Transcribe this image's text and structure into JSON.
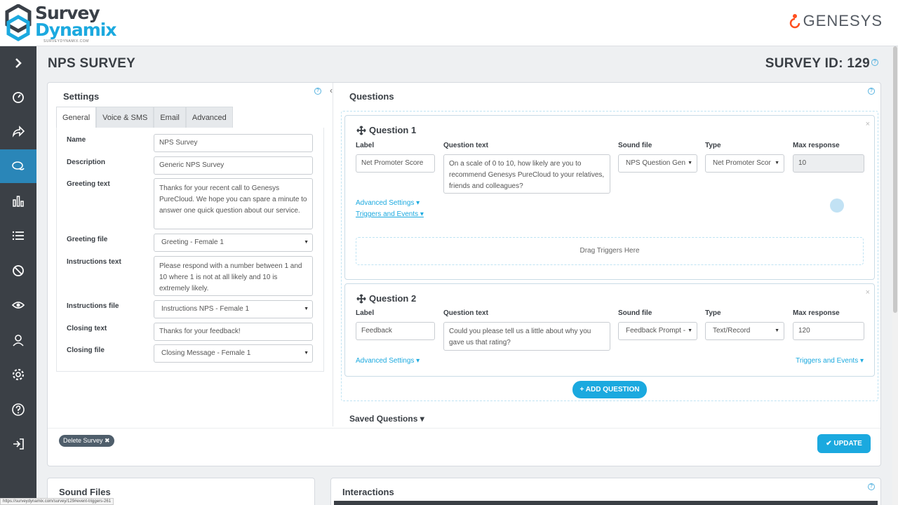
{
  "brand": {
    "logo_line1": "Survey",
    "logo_line2": "Dynamix",
    "logo_sub": "SURVEYDYNAMIX.COM",
    "partner": "GENESYS"
  },
  "sidebar": {
    "items": [
      {
        "icon": "chevron-right-icon"
      },
      {
        "icon": "dashboard-icon"
      },
      {
        "icon": "share-icon"
      },
      {
        "icon": "chat-icon",
        "active": true
      },
      {
        "icon": "bar-chart-icon"
      },
      {
        "icon": "list-icon"
      },
      {
        "icon": "block-icon"
      },
      {
        "icon": "eye-icon"
      },
      {
        "icon": "user-icon"
      },
      {
        "icon": "gear-icon"
      },
      {
        "icon": "help-icon"
      },
      {
        "icon": "logout-icon"
      }
    ]
  },
  "page": {
    "title": "NPS SURVEY",
    "survey_id": "SURVEY ID: 129"
  },
  "settings": {
    "title": "Settings",
    "tabs": [
      "General",
      "Voice & SMS",
      "Email",
      "Advanced"
    ],
    "fields": {
      "name_label": "Name",
      "name_value": "NPS Survey",
      "description_label": "Description",
      "description_value": "Generic NPS Survey",
      "greeting_text_label": "Greeting text",
      "greeting_text_value": "Thanks for your recent call to Genesys PureCloud. We hope you can spare a minute to answer one quick question about our service.",
      "greeting_file_label": "Greeting file",
      "greeting_file_value": "Greeting - Female 1",
      "instructions_text_label": "Instructions text",
      "instructions_text_value": "Please respond with a number between 1 and 10 where 1 is not at all likely and 10 is extremely likely.",
      "instructions_file_label": "Instructions file",
      "instructions_file_value": "Instructions NPS - Female 1",
      "closing_text_label": "Closing text",
      "closing_text_value": "Thanks for your feedback!",
      "closing_file_label": "Closing file",
      "closing_file_value": "Closing Message - Female 1"
    }
  },
  "questions": {
    "title": "Questions",
    "columns": {
      "label": "Label",
      "question_text": "Question text",
      "sound_file": "Sound file",
      "type": "Type",
      "max_response": "Max response"
    },
    "items": [
      {
        "title": "Question 1",
        "label": "Net Promoter Score",
        "question_text": "On a scale of 0 to 10, how likely are you to recommend Genesys PureCloud to your relatives, friends and colleagues?",
        "sound_file": "NPS Question Gen",
        "type": "Net Promoter Scor",
        "max_response": "10",
        "advanced_settings": "Advanced Settings ▾",
        "triggers": "Triggers and Events ▾",
        "drop_zone": "Drag Triggers Here"
      },
      {
        "title": "Question 2",
        "label": "Feedback",
        "question_text": "Could you please tell us a little about why you gave us that rating?",
        "sound_file": "Feedback Prompt -",
        "type": "Text/Record",
        "max_response": "120",
        "advanced_settings": "Advanced Settings ▾",
        "triggers": "Triggers and Events ▾"
      }
    ],
    "add_button": "+ ADD QUESTION",
    "saved_questions": "Saved Questions ▾"
  },
  "actions": {
    "delete": "Delete Survey ✖",
    "update": "✔ UPDATE"
  },
  "bottom": {
    "sound_files": "Sound Files",
    "interactions": "Interactions"
  },
  "status_url": "https://surveydynamix.com/survey/129#event-triggers-261",
  "colors": {
    "accent": "#1ba9df",
    "sidebar": "#3b4046",
    "sidebar_active": "#2a86b8",
    "genesys_orange": "#ff4f1f"
  }
}
